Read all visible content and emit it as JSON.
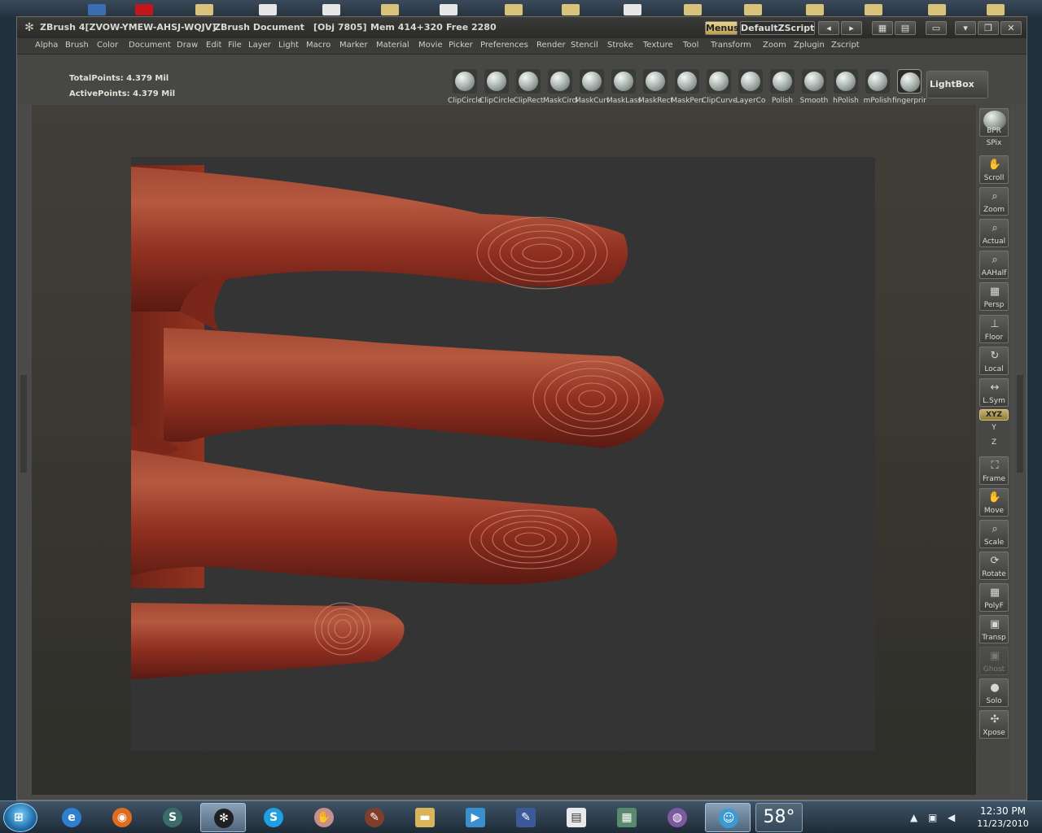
{
  "window": {
    "app_title": "ZBrush 4[ZVOW-YMEW-AHSJ-WQJV]",
    "document_title": "ZBrush Document",
    "obj_info": "[Obj 7805]",
    "mem_info": "Mem 414+320",
    "free_info": "Free 2280",
    "menus_label": "Menus",
    "script_label": "DefaultZScript"
  },
  "menubar": [
    "Alpha",
    "Brush",
    "Color",
    "Document",
    "Draw",
    "Edit",
    "File",
    "Layer",
    "Light",
    "Macro",
    "Marker",
    "Material",
    "Movie",
    "Picker",
    "Preferences",
    "Render",
    "Stencil",
    "Stroke",
    "Texture",
    "Tool",
    "Transform",
    "Zoom",
    "Zplugin",
    "Zscript"
  ],
  "stats": {
    "total_points": "TotalPoints: 4.379 Mil",
    "active_points": "ActivePoints: 4.379 Mil"
  },
  "brushes": [
    "ClipCircle",
    "ClipCircleCenter",
    "ClipRect",
    "MaskCircle",
    "MaskCurve",
    "MaskLasso",
    "MaskRect",
    "MaskPen",
    "ClipCurve",
    "LayerCo",
    "Polish",
    "Smooth",
    "hPolish",
    "mPolish",
    "fingerprint"
  ],
  "lightbox_label": "LightBox",
  "rightbar": {
    "bpr": "BPR",
    "spix": "SPix",
    "scroll": "Scroll",
    "zoom": "Zoom",
    "actual": "Actual",
    "aahalf": "AAHalf",
    "persp": "Persp",
    "floor": "Floor",
    "local": "Local",
    "lsym": "L.Sym",
    "xyz": "XYZ",
    "y": "Y",
    "z": "Z",
    "frame": "Frame",
    "move": "Move",
    "scale": "Scale",
    "rotate": "Rotate",
    "polyf": "PolyF",
    "transp": "Transp",
    "ghost": "Ghost",
    "solo": "Solo",
    "xpose": "Xpose"
  },
  "taskbar": {
    "temperature": "58°",
    "time": "12:30 PM",
    "date": "11/23/2010"
  },
  "colors": {
    "skin": "#8e2e20",
    "skin_highlight": "#b4573f",
    "viewport_bg": "#343434",
    "accent_gold": "#c7b36e"
  }
}
